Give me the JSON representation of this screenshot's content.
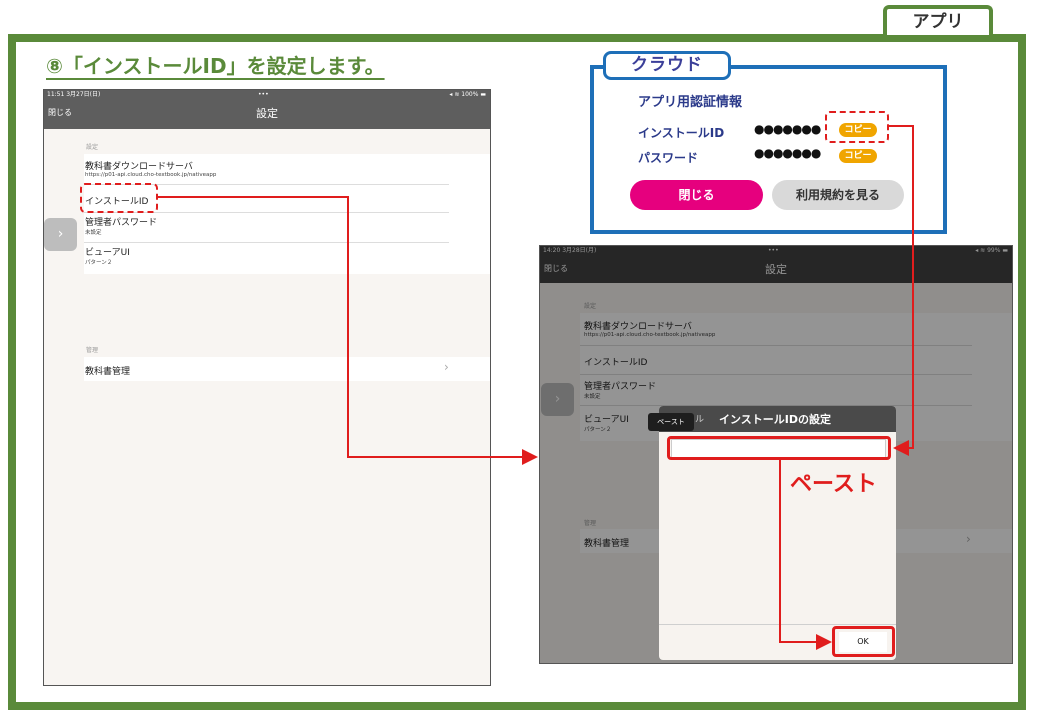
{
  "app_tag": "アプリ",
  "step_title": "⑧「インストールID」を設定します。",
  "left_tablet": {
    "status_time": "11:51  3月27日(日)",
    "status_center": "•••",
    "status_right": "100%",
    "close": "閉じる",
    "title": "設定",
    "section_settings": "設定",
    "items": [
      {
        "title": "教科書ダウンロードサーバ",
        "sub": "https://p01-api.cloud.cho-textbook.jp/nativeapp"
      },
      {
        "title": "インストールID",
        "sub": ""
      },
      {
        "title": "管理者パスワード",
        "sub": "未設定"
      },
      {
        "title": "ビューアUI",
        "sub": "パターン２"
      }
    ],
    "section_manage": "管理",
    "manage_item": "教科書管理",
    "chevron": "›",
    "handle": "›"
  },
  "cloud": {
    "tag": "クラウド",
    "heading": "アプリ用認証情報",
    "rows": [
      {
        "label": "インストールID",
        "value": "●●●●●●●",
        "button": "コピー"
      },
      {
        "label": "パスワード",
        "value": "●●●●●●●",
        "button": "コピー"
      }
    ],
    "close_button": "閉じる",
    "terms_button": "利用規約を見る",
    "colors": {
      "close": "#e6007e",
      "terms": "#d9d9d9",
      "copy": "#f0a500",
      "border": "#1e6fb8"
    }
  },
  "right_tablet": {
    "status_time": "14:20  3月28日(月)",
    "status_center": "•••",
    "status_right": "99%",
    "close": "閉じる",
    "title": "設定",
    "section_settings": "設定",
    "items": [
      {
        "title": "教科書ダウンロードサーバ",
        "sub": "https://p01-api.cloud.cho-textbook.jp/nativeapp"
      },
      {
        "title": "インストールID",
        "sub": ""
      },
      {
        "title": "管理者パスワード",
        "sub": "未設定"
      },
      {
        "title": "ビューアUI",
        "sub": "パターン２"
      }
    ],
    "section_manage": "管理",
    "manage_item": "教科書管理",
    "chevron": "›",
    "handle": "›",
    "dialog": {
      "title": "インストールIDの設定",
      "hidden_left": "ル",
      "paste_popup": "ペースト",
      "input_value": "",
      "ok": "OK"
    }
  },
  "annotation_paste": "ペースト",
  "colors": {
    "frame": "#5a8a3a",
    "annotation": "#e01d1d",
    "nav": "#5e5e5e"
  }
}
